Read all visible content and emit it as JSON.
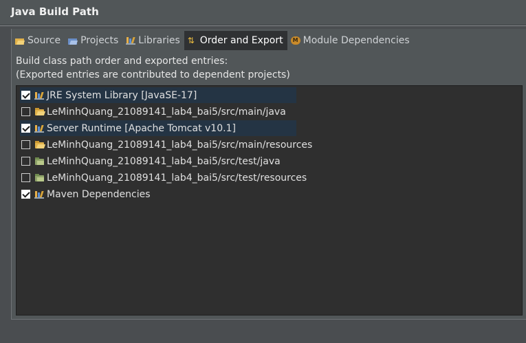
{
  "window": {
    "title": "Java Build Path"
  },
  "tabs": [
    {
      "label": "Source",
      "icon": "source-folder-icon"
    },
    {
      "label": "Projects",
      "icon": "projects-icon"
    },
    {
      "label": "Libraries",
      "icon": "libraries-icon"
    },
    {
      "label": "Order and Export",
      "icon": "order-export-icon",
      "active": true
    },
    {
      "label": "Module Dependencies",
      "icon": "module-icon"
    }
  ],
  "description": {
    "line1": "Build class path order and exported entries:",
    "line2": "(Exported entries are contributed to dependent projects)"
  },
  "entries": [
    {
      "label": "JRE System Library [JavaSE-17]",
      "checked": true,
      "selected": true,
      "icon": "library-icon"
    },
    {
      "label": "LeMinhQuang_21089141_lab4_bai5/src/main/java",
      "checked": false,
      "selected": false,
      "icon": "source-folder-icon"
    },
    {
      "label": "Server Runtime [Apache Tomcat v10.1]",
      "checked": true,
      "selected": true,
      "icon": "library-icon"
    },
    {
      "label": "LeMinhQuang_21089141_lab4_bai5/src/main/resources",
      "checked": false,
      "selected": false,
      "icon": "source-folder-icon"
    },
    {
      "label": "LeMinhQuang_21089141_lab4_bai5/src/test/java",
      "checked": false,
      "selected": false,
      "icon": "test-folder-icon"
    },
    {
      "label": "LeMinhQuang_21089141_lab4_bai5/src/test/resources",
      "checked": false,
      "selected": false,
      "icon": "test-folder-icon"
    },
    {
      "label": "Maven Dependencies",
      "checked": true,
      "selected": false,
      "icon": "library-icon"
    }
  ],
  "colors": {
    "background": "#4a4d50",
    "list_background": "#2f2f2f",
    "selection": "#243444",
    "active_tab": "#2f3133"
  }
}
